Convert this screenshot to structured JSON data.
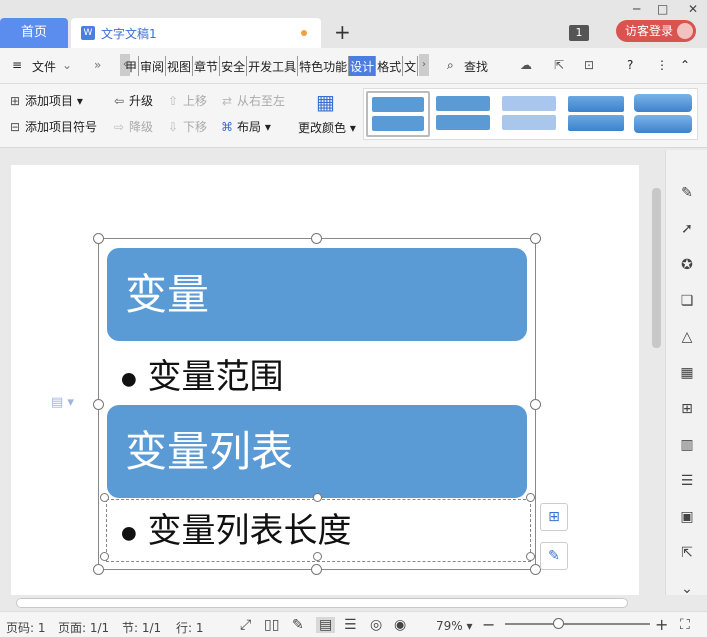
{
  "titlebar": {
    "home_tab": "首页",
    "doc_tab": "文字文稿1",
    "doc_icon": "W",
    "new_tab": "+",
    "notification_count": "1",
    "login_label": "访客登录",
    "min_label": "─",
    "max_label": "□",
    "close_label": "✕"
  },
  "menubar": {
    "file_label": "文件",
    "file_icon": "≡",
    "more_icon": "»",
    "tabs": [
      "审阅",
      "视图",
      "章节",
      "安全",
      "开发工具",
      "特色功能",
      "设计",
      "格式",
      "文"
    ],
    "tab_partial": "甲",
    "active_tab": "设计",
    "search_label": "查找",
    "search_icon": "🔍",
    "left_arrow": "‹",
    "right_arrow": "›",
    "help_icon": "?",
    "menu_icon": "⋮",
    "collapse_icon": "⌃"
  },
  "ribbon": {
    "add_item": "添加项目",
    "add_item_bullet": "添加项目符号",
    "promote": "升级",
    "demote": "降级",
    "move_up": "上移",
    "move_down": "下移",
    "right_to_left": "从右至左",
    "layout": "布局",
    "change_color": "更改颜色"
  },
  "document": {
    "heading1": "变量",
    "bullet1": "变量范围",
    "heading2": "变量列表",
    "bullet2": "变量列表长度",
    "bullet_glyph": "●",
    "box_color": "#5b9bd5"
  },
  "statusbar": {
    "page_code": "页码: 1",
    "page": "页面: 1/1",
    "section": "节: 1/1",
    "row": "行: 1",
    "zoom": "79%",
    "zoom_minus": "−",
    "zoom_plus": "+"
  },
  "colors": {
    "accent": "#4a7fe0",
    "login_bg": "#d9534f",
    "smartart_fill": "#5b9bd5"
  }
}
